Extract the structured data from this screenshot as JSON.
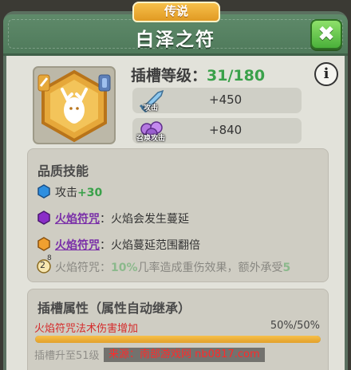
{
  "rarity": "传说",
  "title": "白泽之符",
  "close_glyph": "✖",
  "slot_level": {
    "label": "插槽等级：",
    "value": "31/180"
  },
  "info_glyph": "i",
  "stats": [
    {
      "icon": "sword-icon",
      "icon_label": "攻击",
      "value": "+450"
    },
    {
      "icon": "summon-orb-icon",
      "icon_label": "召唤攻击",
      "value": "+840"
    }
  ],
  "quality_skills": {
    "title": "品质技能",
    "rows": [
      {
        "gem": "blue-gem-icon",
        "prefix": "攻击",
        "bonus": "+30"
      },
      {
        "gem": "purple-gem-icon",
        "name": "火焰符咒",
        "sep": "：",
        "desc": "火焰会发生蔓延"
      },
      {
        "gem": "orange-gem-icon",
        "name": "火焰符咒",
        "sep": "：",
        "desc": "火焰蔓延范围翻倍"
      },
      {
        "badge": "2",
        "badge_sup": "8",
        "name": "火焰符咒：",
        "pct": "10%",
        "desc": "几率造成重伤效果，额外承受",
        "tail": "5"
      }
    ]
  },
  "slot_attributes": {
    "title": "插槽属性（属性自动继承）",
    "effect": "火焰符咒法术伤害增加",
    "progress_text": "50%/50%",
    "progress": 1.0,
    "next": "插槽升至51级"
  },
  "watermark": "来源：南部游戏网   nb0817.com",
  "colors": {
    "accent_green": "#3aa14a",
    "skill_purple": "#7a2fa8",
    "effect_red": "#d42b2b",
    "header_green": "#5f8a6a"
  }
}
